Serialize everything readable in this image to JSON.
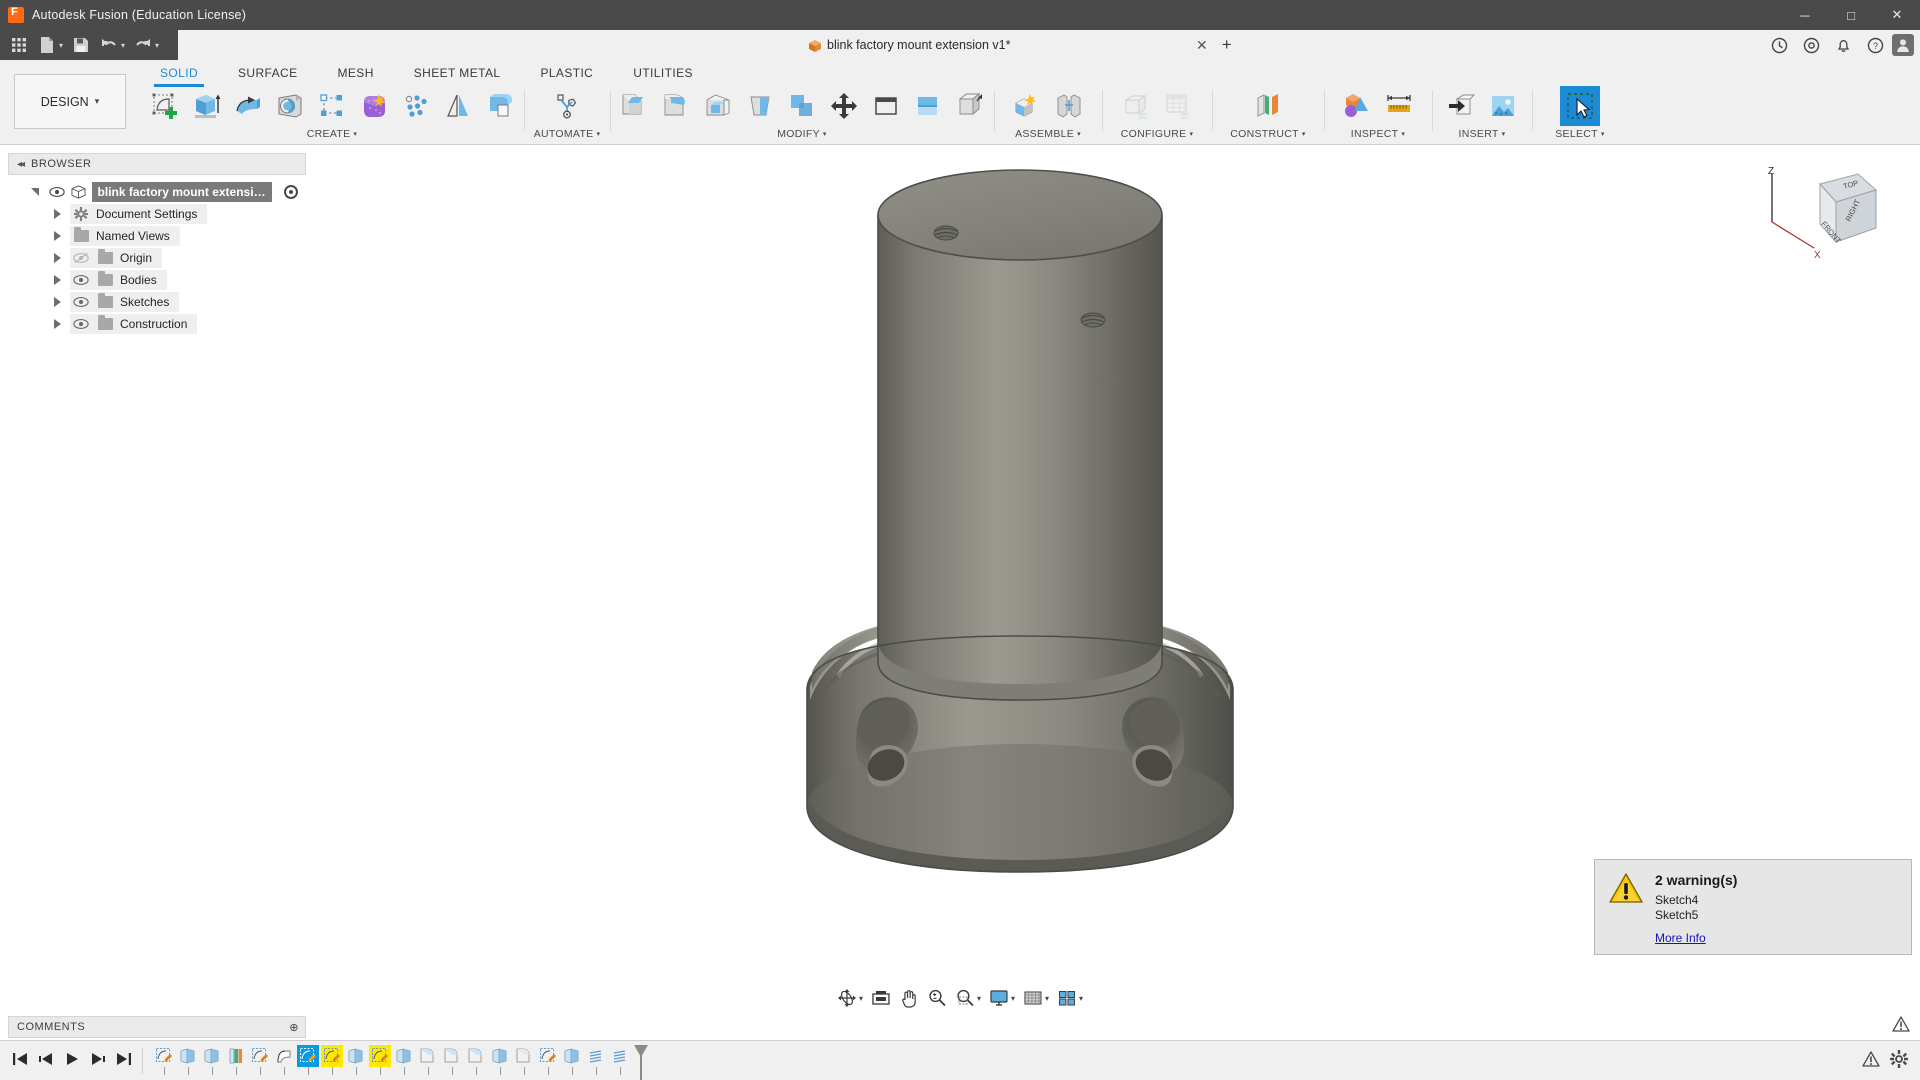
{
  "window": {
    "app_title": "Autodesk Fusion (Education License)",
    "logo_letter": "F",
    "controls": {
      "minimize": "─",
      "maximize": "□",
      "close": "✕"
    }
  },
  "quick_access": {
    "items": [
      {
        "name": "app-grid-icon",
        "label": "Apps"
      },
      {
        "name": "new-document-icon",
        "label": "New",
        "caret": true
      },
      {
        "name": "save-icon",
        "label": "Save"
      },
      {
        "name": "undo-icon",
        "label": "Undo",
        "caret": true
      },
      {
        "name": "redo-icon",
        "label": "Redo",
        "caret": true
      }
    ]
  },
  "document_tab": {
    "title": "blink factory mount extension v1*",
    "close_label": "✕",
    "add_label": "+"
  },
  "strip_right": {
    "items": [
      {
        "name": "job-status-icon",
        "label": "Job Status"
      },
      {
        "name": "extensions-icon",
        "label": "Extensions"
      },
      {
        "name": "notifications-icon",
        "label": "Notifications"
      },
      {
        "name": "help-icon",
        "label": "Help"
      }
    ],
    "avatar_initial": "👤"
  },
  "ribbon": {
    "workspace": {
      "label": "DESIGN",
      "caret": "▾"
    },
    "tabs": [
      {
        "label": "SOLID",
        "active": true
      },
      {
        "label": "SURFACE",
        "active": false
      },
      {
        "label": "MESH",
        "active": false
      },
      {
        "label": "SHEET METAL",
        "active": false
      },
      {
        "label": "PLASTIC",
        "active": false
      },
      {
        "label": "UTILITIES",
        "active": false
      }
    ],
    "panels": [
      {
        "label": "CREATE",
        "has_caret": true,
        "commands": [
          {
            "name": "create-sketch-icon",
            "label": "Create Sketch",
            "state": "normal"
          },
          {
            "name": "extrude-icon",
            "label": "Extrude",
            "state": "normal"
          },
          {
            "name": "revolve-icon",
            "label": "Revolve",
            "state": "normal"
          },
          {
            "name": "hole-icon",
            "label": "Hole",
            "state": "normal"
          },
          {
            "name": "rectangular-pattern-icon",
            "label": "Rectangular Pattern",
            "state": "normal"
          },
          {
            "name": "create-form-icon",
            "label": "Create Form",
            "state": "normal"
          },
          {
            "name": "point-cloud-icon",
            "label": "Points",
            "state": "normal"
          },
          {
            "name": "mirror-icon",
            "label": "Mirror",
            "state": "normal"
          },
          {
            "name": "thicken-icon",
            "label": "Thicken",
            "state": "normal"
          }
        ]
      },
      {
        "label": "AUTOMATE",
        "has_caret": true,
        "commands": [
          {
            "name": "automated-modeling-icon",
            "label": "Automated Modeling",
            "state": "normal"
          }
        ]
      },
      {
        "label": "MODIFY",
        "has_caret": true,
        "commands": [
          {
            "name": "press-pull-icon",
            "label": "Press Pull",
            "state": "normal"
          },
          {
            "name": "fillet-icon",
            "label": "Fillet",
            "state": "normal"
          },
          {
            "name": "shell-icon",
            "label": "Shell",
            "state": "normal"
          },
          {
            "name": "draft-icon",
            "label": "Draft",
            "state": "normal"
          },
          {
            "name": "scale-icon",
            "label": "Scale",
            "state": "normal"
          },
          {
            "name": "move-copy-icon",
            "label": "Move/Copy",
            "state": "normal"
          },
          {
            "name": "align-icon",
            "label": "Align",
            "state": "normal"
          },
          {
            "name": "combine-icon",
            "label": "Combine",
            "state": "normal"
          },
          {
            "name": "split-body-icon",
            "label": "Split Body",
            "state": "normal"
          }
        ]
      },
      {
        "label": "ASSEMBLE",
        "has_caret": true,
        "commands": [
          {
            "name": "new-component-icon",
            "label": "New Component",
            "state": "normal"
          },
          {
            "name": "joint-icon",
            "label": "Joint",
            "state": "normal"
          }
        ]
      },
      {
        "label": "CONFIGURE",
        "has_caret": true,
        "commands": [
          {
            "name": "configuration-icon",
            "label": "Create Configuration",
            "state": "disabled"
          },
          {
            "name": "configuration-table-icon",
            "label": "Configuration Table",
            "state": "disabled"
          }
        ]
      },
      {
        "label": "CONSTRUCT",
        "has_caret": true,
        "commands": [
          {
            "name": "offset-plane-icon",
            "label": "Offset Plane",
            "state": "normal"
          }
        ]
      },
      {
        "label": "INSPECT",
        "has_caret": true,
        "commands": [
          {
            "name": "interference-icon",
            "label": "Interference",
            "state": "normal"
          },
          {
            "name": "measure-icon",
            "label": "Measure",
            "state": "normal"
          }
        ]
      },
      {
        "label": "INSERT",
        "has_caret": true,
        "commands": [
          {
            "name": "insert-derive-icon",
            "label": "Derive",
            "state": "normal"
          },
          {
            "name": "insert-canvas-icon",
            "label": "Canvas",
            "state": "normal"
          }
        ]
      },
      {
        "label": "SELECT",
        "has_caret": true,
        "commands": [
          {
            "name": "select-tool-icon",
            "label": "Select",
            "state": "selected"
          }
        ]
      }
    ]
  },
  "browser": {
    "header": "BROWSER",
    "collapse_icon": "◂◂",
    "root": {
      "label": "blink factory mount extensio..",
      "visible": true
    },
    "items": [
      {
        "label": "Document Settings",
        "icon": "gear-icon",
        "has_eye": false
      },
      {
        "label": "Named Views",
        "icon": "folder-icon",
        "has_eye": false
      },
      {
        "label": "Origin",
        "icon": "folder-icon",
        "has_eye": true,
        "eye_state": "hidden"
      },
      {
        "label": "Bodies",
        "icon": "folder-icon",
        "has_eye": true,
        "eye_state": "visible"
      },
      {
        "label": "Sketches",
        "icon": "folder-icon",
        "has_eye": true,
        "eye_state": "visible"
      },
      {
        "label": "Construction",
        "icon": "folder-icon",
        "has_eye": true,
        "eye_state": "visible"
      }
    ]
  },
  "viewcube": {
    "faces": {
      "top": "TOP",
      "front": "FRONT",
      "right": "RIGHT"
    },
    "axes": {
      "z": "Z",
      "x": "X"
    }
  },
  "warning_panel": {
    "title": "2 warning(s)",
    "lines": [
      "Sketch4",
      "Sketch5"
    ],
    "more_info": "More Info",
    "icon": "warning-triangle-icon",
    "accent": "#f5c400"
  },
  "nav_bar": {
    "items": [
      {
        "name": "orbit-icon",
        "label": "Orbit",
        "caret": true
      },
      {
        "name": "fit-icon",
        "label": "Fit",
        "caret": false
      },
      {
        "name": "pan-icon",
        "label": "Pan",
        "caret": false
      },
      {
        "name": "zoom-icon",
        "label": "Zoom",
        "caret": false
      },
      {
        "name": "zoom-window-icon",
        "label": "Zoom Window",
        "caret": true
      },
      {
        "name": "display-settings-icon",
        "label": "Display Settings",
        "caret": true
      },
      {
        "name": "grid-snaps-icon",
        "label": "Grid and Snaps",
        "caret": true
      },
      {
        "name": "viewports-icon",
        "label": "Viewports",
        "caret": true
      }
    ]
  },
  "comments": {
    "label": "COMMENTS",
    "expand": "⊕"
  },
  "timeline": {
    "playback": [
      {
        "name": "timeline-first-icon",
        "label": "Go to beginning"
      },
      {
        "name": "timeline-prev-icon",
        "label": "Step back"
      },
      {
        "name": "timeline-play-icon",
        "label": "Play"
      },
      {
        "name": "timeline-next-icon",
        "label": "Step forward"
      },
      {
        "name": "timeline-last-icon",
        "label": "Go to end"
      }
    ],
    "nodes": [
      {
        "name": "timeline-sketch-node",
        "type": "sketch",
        "state": "normal"
      },
      {
        "name": "timeline-extrude-node",
        "type": "extrude",
        "state": "normal"
      },
      {
        "name": "timeline-extrude-node",
        "type": "extrude",
        "state": "normal"
      },
      {
        "name": "timeline-thread-node",
        "type": "thread",
        "state": "normal"
      },
      {
        "name": "timeline-sketch-node",
        "type": "sketch",
        "state": "normal"
      },
      {
        "name": "timeline-revolve-node",
        "type": "revolve",
        "state": "normal"
      },
      {
        "name": "timeline-sketch-node",
        "type": "sketch",
        "state": "selected-blue"
      },
      {
        "name": "timeline-sketch-node",
        "type": "sketch",
        "state": "warning-yellow"
      },
      {
        "name": "timeline-extrude-node",
        "type": "extrude",
        "state": "normal"
      },
      {
        "name": "timeline-sketch-node",
        "type": "sketch",
        "state": "warning-yellow"
      },
      {
        "name": "timeline-extrude-node",
        "type": "extrude",
        "state": "normal"
      },
      {
        "name": "timeline-fillet-node",
        "type": "fillet",
        "state": "normal"
      },
      {
        "name": "timeline-fillet-node",
        "type": "fillet",
        "state": "normal"
      },
      {
        "name": "timeline-fillet-node",
        "type": "fillet",
        "state": "normal"
      },
      {
        "name": "timeline-extrude-node",
        "type": "extrude",
        "state": "normal"
      },
      {
        "name": "timeline-fillet-node",
        "type": "fillet",
        "state": "normal"
      },
      {
        "name": "timeline-sketch-node",
        "type": "sketch",
        "state": "normal"
      },
      {
        "name": "timeline-extrude-node",
        "type": "extrude",
        "state": "normal"
      },
      {
        "name": "timeline-thread2-node",
        "type": "thread2",
        "state": "normal"
      },
      {
        "name": "timeline-thread2-node",
        "type": "thread2",
        "state": "normal"
      }
    ],
    "status_warning_icon": "warning-triangle-icon",
    "settings_icon": "gear-icon"
  },
  "colors": {
    "titlebar_bg": "#4a4a4a",
    "ribbon_bg": "#f0f0f0",
    "accent_blue": "#1c8ad4",
    "select_blue": "#0a9ae0",
    "warning_yellow": "#ffe800",
    "model_gray": "#7b7a72",
    "link_blue": "#1515c0"
  }
}
